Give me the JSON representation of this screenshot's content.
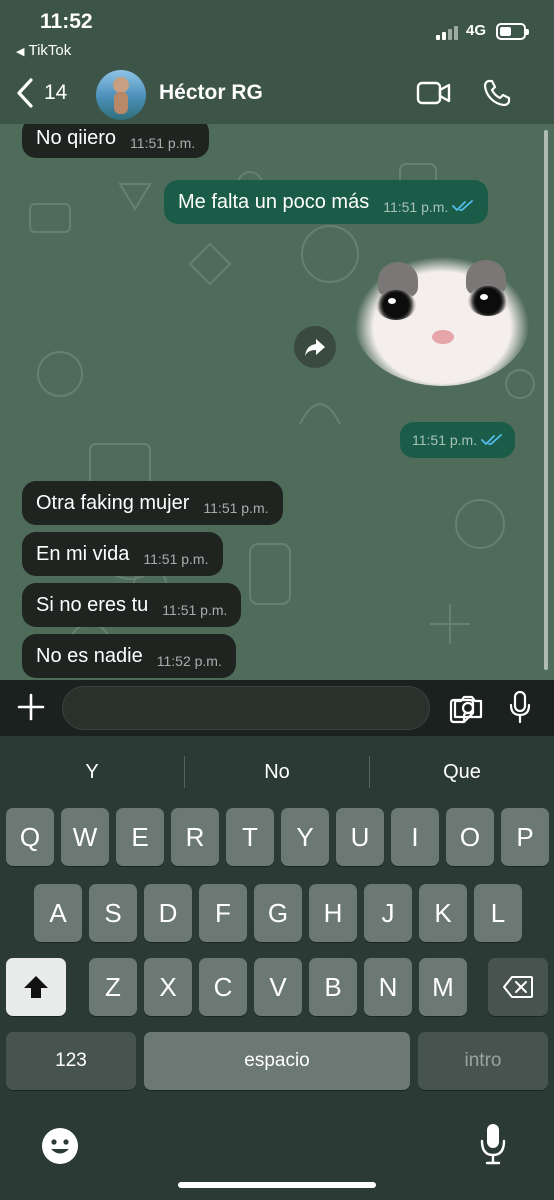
{
  "status_bar": {
    "time": "11:52",
    "back_app": "TikTok",
    "network": "4G"
  },
  "header": {
    "back_count": "14",
    "contact_name": "Héctor RG"
  },
  "messages": [
    {
      "dir": "in",
      "text": "No qiiero",
      "time": "11:51 p.m."
    },
    {
      "dir": "out",
      "text": "Me falta un poco más",
      "time": "11:51 p.m.",
      "read": true
    },
    {
      "dir": "out",
      "type": "sticker",
      "text": "",
      "time": "11:51 p.m.",
      "read": true
    },
    {
      "dir": "in",
      "text": "Otra faking mujer",
      "time": "11:51 p.m."
    },
    {
      "dir": "in",
      "text": "En mi vida",
      "time": "11:51 p.m."
    },
    {
      "dir": "in",
      "text": "Si no eres tu",
      "time": "11:51 p.m."
    },
    {
      "dir": "in",
      "text": "No es nadie",
      "time": "11:52 p.m."
    }
  ],
  "input": {
    "placeholder": ""
  },
  "keyboard": {
    "suggestions": [
      "Y",
      "No",
      "Que"
    ],
    "row1": [
      "Q",
      "W",
      "E",
      "R",
      "T",
      "Y",
      "U",
      "I",
      "O",
      "P"
    ],
    "row2": [
      "A",
      "S",
      "D",
      "F",
      "G",
      "H",
      "J",
      "K",
      "L"
    ],
    "row3": [
      "Z",
      "X",
      "C",
      "V",
      "B",
      "N",
      "M"
    ],
    "numbers_label": "123",
    "space_label": "espacio",
    "return_label": "intro"
  },
  "colors": {
    "incoming_bubble": "#1f2421",
    "outgoing_bubble": "#1a5c48",
    "read_ticks": "#53bdeb"
  },
  "icons": [
    "back-chevron",
    "video-call",
    "phone",
    "plus",
    "sticker",
    "camera",
    "microphone",
    "forward",
    "shift",
    "backspace",
    "emoji",
    "dictation-mic"
  ]
}
